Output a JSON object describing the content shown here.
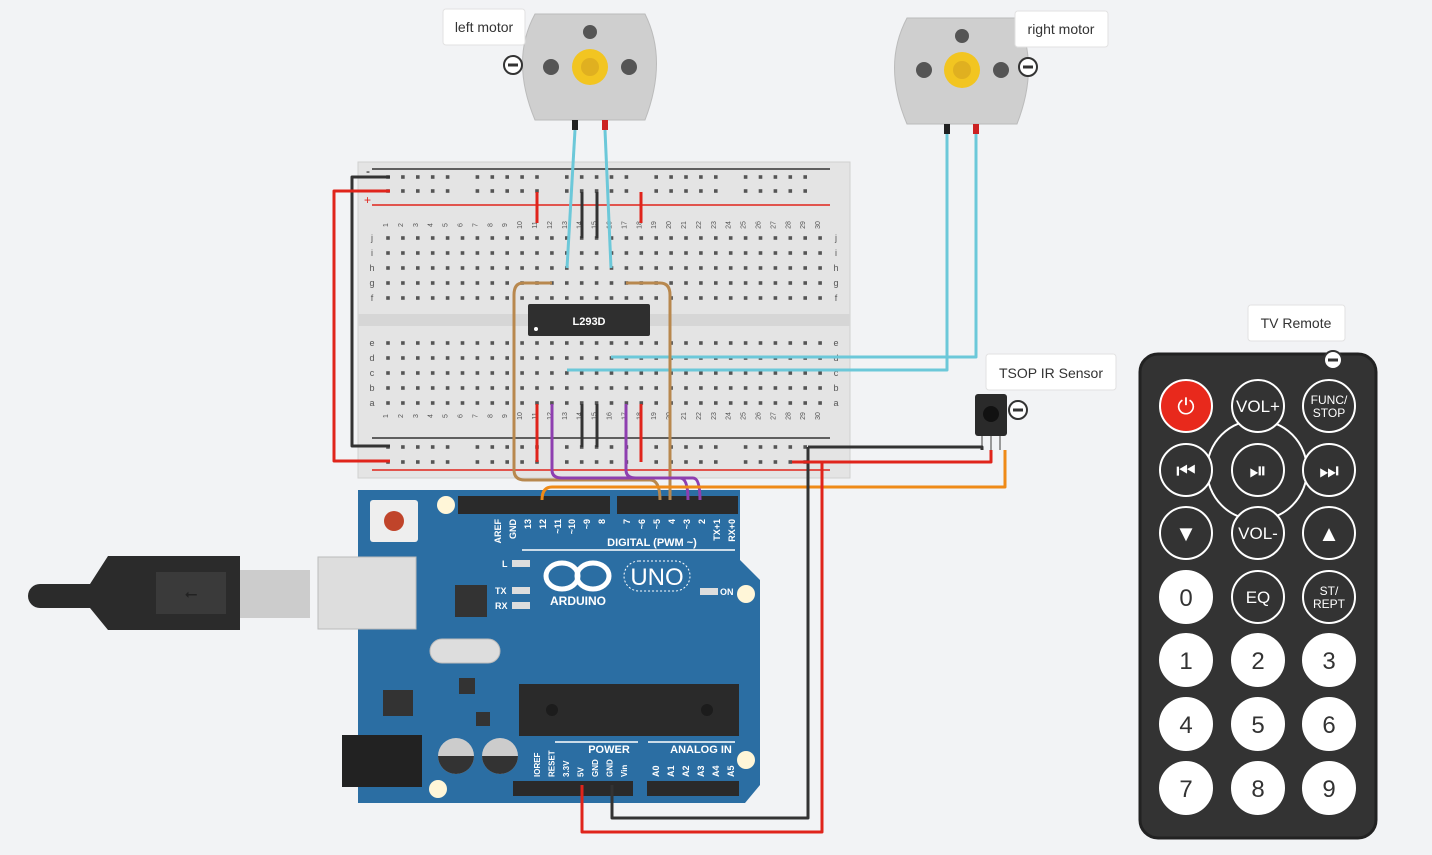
{
  "labels": {
    "left_motor": "left motor",
    "right_motor": "right motor",
    "ir_sensor": "TSOP IR Sensor",
    "remote": "TV Remote"
  },
  "chip": "L293D",
  "breadboard": {
    "row_letters_top": [
      "j",
      "i",
      "h",
      "g",
      "f"
    ],
    "row_letters_bottom": [
      "e",
      "d",
      "c",
      "b",
      "a"
    ],
    "columns": 30,
    "rail_minus": "-",
    "rail_plus": "+"
  },
  "arduino": {
    "digital_pins": [
      "AREF",
      "GND",
      "13",
      "12",
      "~11",
      "~10",
      "~9",
      "8",
      "7",
      "~6",
      "~5",
      "4",
      "~3",
      "2",
      "TX+1",
      "RX+0"
    ],
    "digital_label": "DIGITAL (PWM ~)",
    "logo": "ARDUINO",
    "model": "UNO",
    "led_l": "L",
    "led_tx": "TX",
    "led_rx": "RX",
    "led_on": "ON",
    "power_label": "POWER",
    "analog_label": "ANALOG IN",
    "power_pins": [
      "IOREF",
      "RESET",
      "3.3V",
      "5V",
      "GND",
      "GND",
      "Vin"
    ],
    "analog_pins": [
      "A0",
      "A1",
      "A2",
      "A3",
      "A4",
      "A5"
    ]
  },
  "remote_buttons": [
    "power",
    "VOL+",
    "FUNC/ STOP",
    "prev",
    "play-pause",
    "next",
    "down",
    "VOL-",
    "up",
    "0",
    "EQ",
    "ST/ REPT",
    "1",
    "2",
    "3",
    "4",
    "5",
    "6",
    "7",
    "8",
    "9"
  ],
  "colors": {
    "background": "#f2f3f5",
    "arduino": "#2b6ea3",
    "remote": "#333333",
    "power_button": "#e8291c",
    "wire_red": "#e0241b",
    "wire_black": "#333333",
    "wire_blue": "#6cc8d9",
    "wire_brown": "#b8884e",
    "wire_purple": "#8e3fb0",
    "wire_orange": "#ef8a17"
  }
}
